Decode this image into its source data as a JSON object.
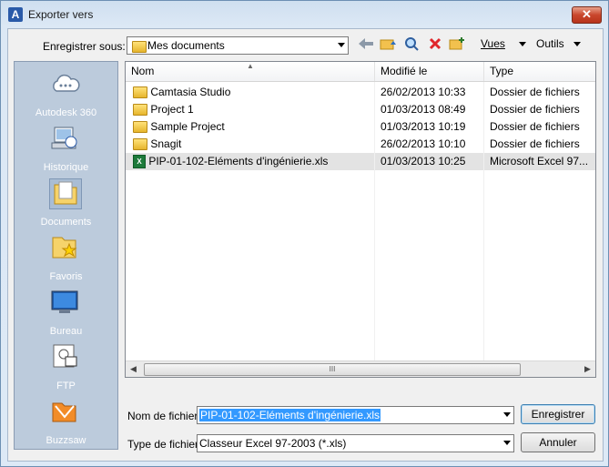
{
  "window": {
    "title": "Exporter vers",
    "close_label": "✕",
    "app_icon_letter": "A"
  },
  "save_in": {
    "label": "Enregistrer sous:",
    "value": "Mes documents"
  },
  "toolbar": {
    "views_label": "Vues",
    "tools_label": "Outils"
  },
  "places": [
    {
      "label": "Autodesk 360",
      "icon": "cloud-icon"
    },
    {
      "label": "Historique",
      "icon": "history-icon"
    },
    {
      "label": "Documents",
      "icon": "documents-folder-icon"
    },
    {
      "label": "Favoris",
      "icon": "favorites-icon"
    },
    {
      "label": "Bureau",
      "icon": "desktop-icon"
    },
    {
      "label": "FTP",
      "icon": "ftp-icon"
    },
    {
      "label": "Buzzsaw",
      "icon": "buzzsaw-icon"
    }
  ],
  "columns": {
    "name": "Nom",
    "modified": "Modifié le",
    "type": "Type"
  },
  "files": [
    {
      "name": "Camtasia Studio",
      "modified": "26/02/2013 10:33",
      "type": "Dossier de fichiers",
      "kind": "folder"
    },
    {
      "name": "Project 1",
      "modified": "01/03/2013 08:49",
      "type": "Dossier de fichiers",
      "kind": "folder"
    },
    {
      "name": "Sample Project",
      "modified": "01/03/2013 10:19",
      "type": "Dossier de fichiers",
      "kind": "folder"
    },
    {
      "name": "Snagit",
      "modified": "26/02/2013 10:10",
      "type": "Dossier de fichiers",
      "kind": "folder"
    },
    {
      "name": "PIP-01-102-Eléments d'ingénierie.xls",
      "modified": "01/03/2013 10:25",
      "type": "Microsoft Excel 97...",
      "kind": "xls"
    }
  ],
  "filename": {
    "label": "Nom de fichier:",
    "value": "PIP-01-102-Eléments d'ingénierie.xls"
  },
  "filetype": {
    "label": "Type de fichier:",
    "value": "Classeur Excel 97-2003 (*.xls)"
  },
  "buttons": {
    "save": "Enregistrer",
    "cancel": "Annuler"
  },
  "scrollbar": {
    "thumb_grip": "III"
  }
}
